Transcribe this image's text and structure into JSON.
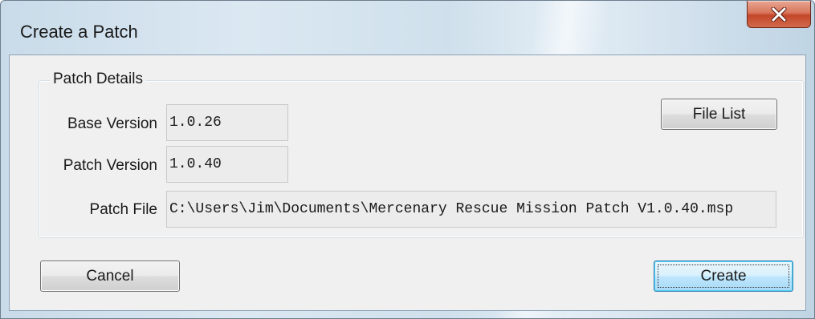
{
  "window": {
    "title": "Create a Patch"
  },
  "titlebar": {
    "close_icon": "close-x-icon"
  },
  "patch_details": {
    "legend": "Patch Details",
    "base_version": {
      "label": "Base Version",
      "value": "1.0.26"
    },
    "patch_version": {
      "label": "Patch Version",
      "value": "1.0.40"
    },
    "patch_file": {
      "label": "Patch File",
      "value": "C:\\Users\\Jim\\Documents\\Mercenary Rescue Mission Patch V1.0.40.msp"
    },
    "file_list_button": "File List"
  },
  "actions": {
    "cancel_label": "Cancel",
    "create_label": "Create"
  },
  "colors": {
    "close_button": "#c4472a",
    "default_button_border": "#3c7fb1",
    "client_background": "#f0f0f0"
  }
}
